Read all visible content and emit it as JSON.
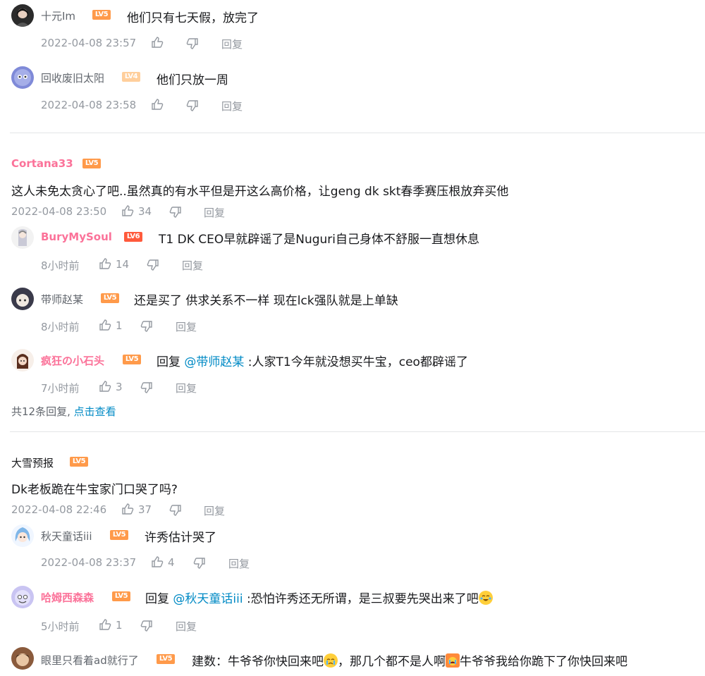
{
  "threads": [
    {
      "replies": [
        {
          "user": "十元Im",
          "level": "LV5",
          "content": "他们只有七天假，放完了",
          "time": "2022-04-08 23:57",
          "likes": "",
          "reply": "回复"
        },
        {
          "user": "回收废旧太阳",
          "level": "LV4",
          "content": "他们只放一周",
          "time": "2022-04-08 23:58",
          "likes": "",
          "reply": "回复"
        }
      ]
    },
    {
      "root": {
        "user": "Cortana33",
        "level": "LV5",
        "content": "这人未免太贪心了吧..虽然真的有水平但是开这么高价格，让geng dk skt春季赛压根放弃买他",
        "time": "2022-04-08 23:50",
        "likes": "34",
        "reply": "回复"
      },
      "replies": [
        {
          "user": "BuryMySoul",
          "level": "LV6",
          "content": "T1 DK CEO早就辟谣了是Nuguri自己身体不舒服一直想休息",
          "time": "8小时前",
          "likes": "14",
          "reply": "回复"
        },
        {
          "user": "带师赵某",
          "level": "LV5",
          "content": "还是买了  供求关系不一样  现在lck强队就是上单缺",
          "time": "8小时前",
          "likes": "1",
          "reply": "回复"
        },
        {
          "user": "疯狂の小石头",
          "level": "LV5",
          "reply_prefix": "回复 ",
          "at": "@带师赵某",
          "content": " :人家T1今年就没想买牛宝，ceo都辟谣了",
          "time": "7小时前",
          "likes": "3",
          "reply": "回复"
        }
      ],
      "footer": {
        "count_text": "共12条回复, ",
        "link": "点击查看"
      }
    },
    {
      "root": {
        "user": "大雪预报",
        "level": "LV5",
        "content": "Dk老板跪在牛宝家门口哭了吗?",
        "time": "2022-04-08 22:46",
        "likes": "37",
        "reply": "回复"
      },
      "replies": [
        {
          "user": "秋天童话iii",
          "level": "LV5",
          "content": "许秀估计哭了",
          "time": "2022-04-08 23:37",
          "likes": "4",
          "reply": "回复"
        },
        {
          "user": "哈姆西森森",
          "level": "LV5",
          "reply_prefix": "回复 ",
          "at": "@秋天童话iii",
          "content": " :恐怕许秀还无所谓，是三叔要先哭出来了吧",
          "time": "5小时前",
          "likes": "1",
          "reply": "回复"
        },
        {
          "user": "眼里只看着ad就行了",
          "level": "LV5",
          "content_a": "建数：牛爷爷你快回来吧",
          "content_b": "，那几个都不是人啊",
          "content_c": "牛爷爷我给你跪下了你快回来吧"
        }
      ]
    }
  ],
  "colors": {
    "accent_pink": "#fb7299",
    "link_blue": "#008ac5",
    "meta_gray": "#9499a0",
    "level5": "#ff9a4a",
    "level4": "#ffcf9c",
    "level6": "#ff5a3c"
  },
  "icons": [
    "thumb-up-icon",
    "thumb-down-icon",
    "crying-laughing-emoji-icon",
    "crying-emoji-icon"
  ]
}
